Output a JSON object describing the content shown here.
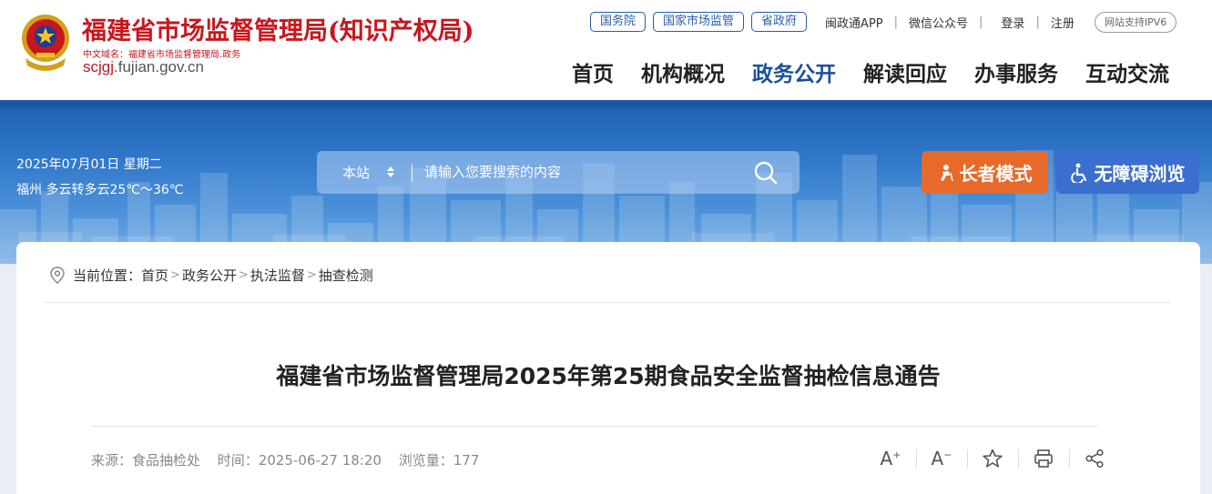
{
  "header": {
    "site_title": "福建省市场监督管理局(知识产权局)",
    "cn_domain": "中文域名：福建省市场监督管理局.政务",
    "en_domain_highlight": "scjgj",
    "en_domain_rest": ".fujian.gov.cn",
    "top_links": {
      "guowuyuan": "国务院",
      "national_market": "国家市场监管",
      "province_gov": "省政府",
      "minzhengtong": "闽政通APP",
      "wechat": "微信公众号",
      "login": "登录",
      "register": "注册",
      "ipv6": "网站支持IPV6"
    },
    "nav": [
      "首页",
      "机构概况",
      "政务公开",
      "解读回应",
      "办事服务",
      "互动交流"
    ],
    "active_nav": "政务公开"
  },
  "banner": {
    "date": "2025年07月01日 星期二",
    "weather": "福州 多云转多云25℃～36℃",
    "search": {
      "scope": "本站",
      "placeholder": "请输入您要搜索的内容"
    },
    "elder_mode": "长者模式",
    "accessible": "无障碍浏览"
  },
  "breadcrumb": {
    "prefix": "当前位置：",
    "items": [
      "首页",
      "政务公开",
      "执法监督",
      "抽查检测"
    ]
  },
  "article": {
    "title": "福建省市场监督管理局2025年第25期食品安全监督抽检信息通告",
    "source": "来源：食品抽检处",
    "time": "时间：2025-06-27 18:20",
    "views": "浏览量：177"
  },
  "tools": [
    "font-increase-icon",
    "font-decrease-icon",
    "star-icon",
    "print-icon",
    "share-icon"
  ],
  "colors": {
    "brand_red": "#c8161d",
    "nav_active": "#1b4f9c",
    "elder_button": "#e86a2a",
    "access_button": "#3a6fcf"
  }
}
